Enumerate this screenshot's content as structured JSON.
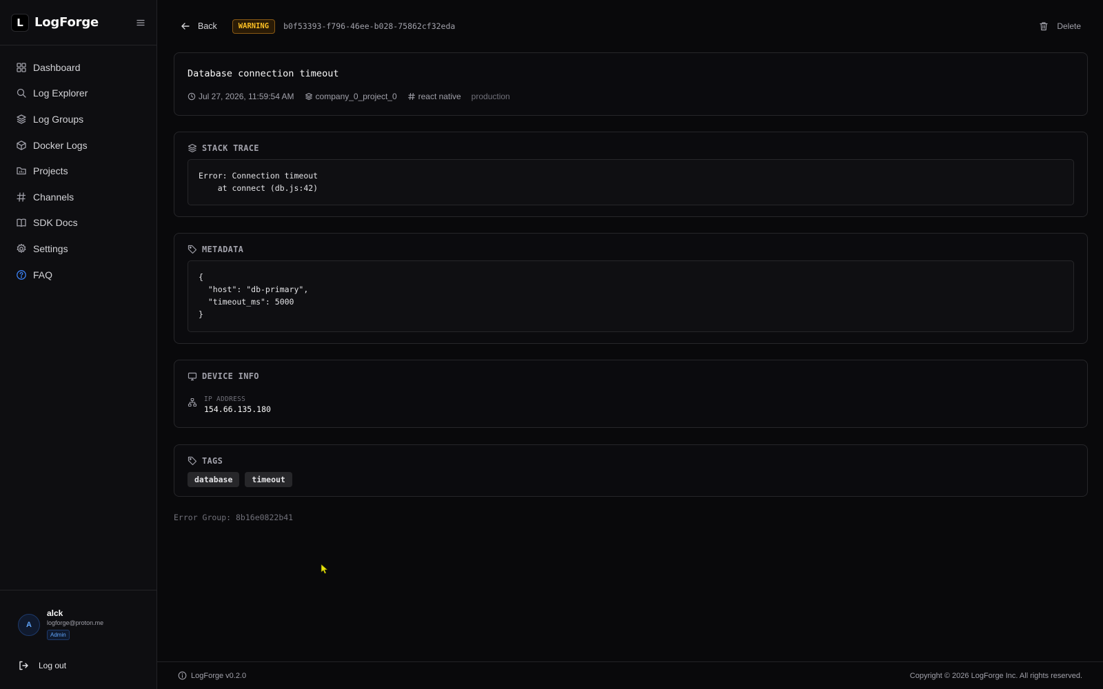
{
  "app": {
    "name": "LogForge",
    "logo_letter": "L",
    "version": "LogForge v0.2.0",
    "copyright": "Copyright © 2026 LogForge Inc. All rights reserved."
  },
  "sidebar": {
    "items": [
      {
        "label": "Dashboard",
        "icon": "grid-icon"
      },
      {
        "label": "Log Explorer",
        "icon": "search-icon"
      },
      {
        "label": "Log Groups",
        "icon": "layers-icon"
      },
      {
        "label": "Docker Logs",
        "icon": "container-icon"
      },
      {
        "label": "Projects",
        "icon": "folder-icon"
      },
      {
        "label": "Channels",
        "icon": "hash-icon"
      },
      {
        "label": "SDK Docs",
        "icon": "book-icon"
      },
      {
        "label": "Settings",
        "icon": "gear-icon"
      },
      {
        "label": "FAQ",
        "icon": "help-circle-icon"
      }
    ],
    "user": {
      "initial": "A",
      "name": "alck",
      "email": "logforge@proton.me",
      "role": "Admin"
    },
    "logout_label": "Log out"
  },
  "header": {
    "back_label": "Back",
    "level": "WARNING",
    "log_id": "b0f53393-f796-46ee-b028-75862cf32eda",
    "delete_label": "Delete"
  },
  "log": {
    "title": "Database connection timeout",
    "timestamp": "Jul 27, 2026, 11:59:54 AM",
    "project": "company_0_project_0",
    "channel": "react native",
    "environment": "production"
  },
  "stack_trace": {
    "title": "STACK TRACE",
    "text": "Error: Connection timeout\n    at connect (db.js:42)"
  },
  "metadata": {
    "title": "METADATA",
    "text": "{\n  \"host\": \"db-primary\",\n  \"timeout_ms\": 5000\n}"
  },
  "device_info": {
    "title": "DEVICE INFO",
    "ip_label": "IP ADDRESS",
    "ip_value": "154.66.135.180"
  },
  "tags": {
    "title": "TAGS",
    "items": [
      "database",
      "timeout"
    ]
  },
  "error_group": "Error Group: 8b16e0822b41",
  "colors": {
    "warning": "#fbbf24",
    "accent": "#3b82f6",
    "background": "#09090b"
  }
}
